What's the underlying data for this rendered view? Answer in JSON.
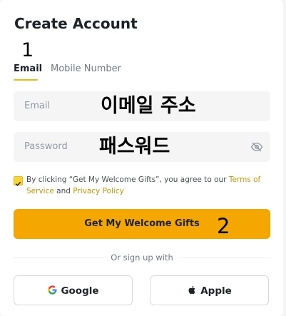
{
  "header": {
    "title": "Create Account"
  },
  "annotations": {
    "one": "1",
    "two": "2"
  },
  "tabs": [
    {
      "label": "Email",
      "active": true
    },
    {
      "label": "Mobile Number",
      "active": false
    }
  ],
  "form": {
    "email": {
      "placeholder": "Email",
      "overlay": "이메일 주소",
      "value": ""
    },
    "password": {
      "placeholder": "Password",
      "overlay": "패스워드",
      "value": "",
      "toggle_icon": "eye-off-icon"
    }
  },
  "consent": {
    "checked": true,
    "prefix": "By clicking “Get My Welcome Gifts”, you agree to our ",
    "terms_link": "Terms of Service",
    "and": " and ",
    "privacy_link": "Privacy Policy"
  },
  "primary_button": {
    "label": "Get My Welcome Gifts"
  },
  "divider": {
    "label": "Or sign up with"
  },
  "social": [
    {
      "label": "Google",
      "icon": "google-icon"
    },
    {
      "label": "Apple",
      "icon": "apple-icon"
    }
  ],
  "colors": {
    "accent": "#f4a700",
    "link": "#c99400",
    "text": "#1e2329",
    "muted": "#707a8a"
  }
}
